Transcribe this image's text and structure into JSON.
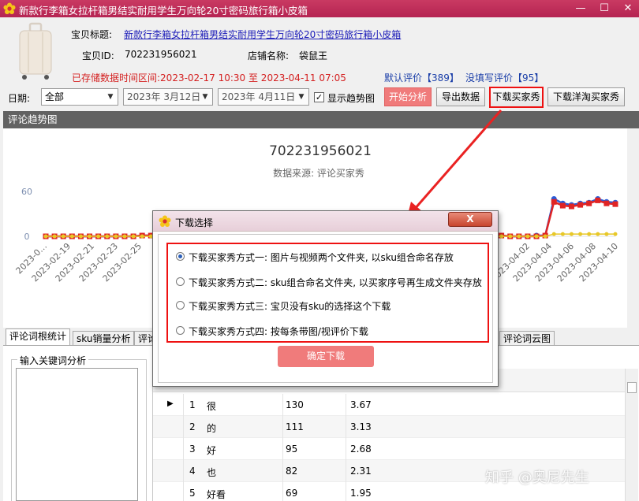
{
  "window": {
    "title": "新款行李箱女拉杆箱男结实耐用学生万向轮20寸密码旅行箱小皮箱",
    "minimize": "—",
    "maximize": "☐",
    "close": "✕"
  },
  "info": {
    "title_label": "宝贝标题:",
    "title_value": "新款行李箱女拉杆箱男结实耐用学生万向轮20寸密码旅行箱小皮箱",
    "id_label": "宝贝ID:",
    "id_value": "702231956021",
    "shop_label": "店铺名称:",
    "shop_value": "袋鼠王",
    "stored_range": "已存储数据时间区间:2023-02-17 10:30 至 2023-04-11 07:05",
    "default_reviews": "默认评价【389】",
    "no_text_reviews": "没填写评价【95】"
  },
  "toolbar": {
    "date_label": "日期:",
    "period": "全部",
    "date_from": "2023年 3月12日",
    "date_to": "2023年 4月11日",
    "show_trend": "显示趋势图",
    "start_analysis": "开始分析",
    "export": "导出数据",
    "download_buyer_show": "下载买家秀",
    "download_global_show": "下载洋淘买家秀"
  },
  "chart_panel_title": "评论趋势图",
  "chart_data": {
    "type": "line",
    "title": "702231956021",
    "subtitle": "数据来源: 评论买家秀",
    "ylim": [
      0,
      60
    ],
    "yticks": [
      "60",
      "0"
    ],
    "x_visible_left": [
      "2023-0…",
      "2023-02-19",
      "2023-02-21",
      "2023-02-23",
      "2023-02-25"
    ],
    "x_visible_right": [
      "2023-04-02",
      "2023-04-04",
      "2023-04-06",
      "2023-04-08",
      "2023-04-10"
    ],
    "series": [
      {
        "color": "#2a5bd7",
        "values": [
          0,
          0,
          0,
          0,
          0,
          0,
          0,
          0,
          0,
          0,
          0,
          1,
          1,
          1,
          1,
          1,
          0,
          1,
          1,
          1,
          1,
          1,
          1,
          1,
          1,
          1,
          1,
          1,
          1,
          1,
          1,
          1,
          1,
          1,
          1,
          1,
          1,
          1,
          1,
          1,
          1,
          1,
          1,
          1,
          1,
          1,
          1,
          1,
          1,
          1,
          1,
          1,
          1,
          0,
          0,
          0,
          1,
          1,
          50,
          44,
          42,
          44,
          45,
          50,
          46,
          45
        ]
      },
      {
        "color": "#e02424",
        "values": [
          0,
          0,
          0,
          0,
          0,
          0,
          0,
          0,
          0,
          0,
          0,
          1,
          1,
          1,
          1,
          1,
          0,
          1,
          1,
          1,
          1,
          1,
          1,
          1,
          1,
          1,
          1,
          1,
          1,
          1,
          1,
          1,
          1,
          1,
          1,
          1,
          1,
          1,
          1,
          1,
          1,
          1,
          1,
          1,
          1,
          1,
          1,
          1,
          1,
          1,
          1,
          1,
          1,
          0,
          0,
          0,
          0,
          1,
          46,
          41,
          40,
          42,
          44,
          48,
          44,
          43
        ]
      },
      {
        "color": "#e8c828",
        "values": [
          0,
          0,
          0,
          0,
          0,
          0,
          0,
          0,
          0,
          0,
          0,
          0,
          0,
          0,
          0,
          0,
          0,
          0,
          0,
          0,
          0,
          0,
          0,
          0,
          0,
          0,
          0,
          0,
          0,
          0,
          0,
          0,
          0,
          0,
          0,
          0,
          0,
          0,
          0,
          0,
          0,
          0,
          0,
          0,
          0,
          0,
          0,
          0,
          0,
          0,
          0,
          0,
          0,
          0,
          0,
          0,
          0,
          0,
          3,
          3,
          3,
          3,
          3,
          3,
          3,
          3
        ]
      }
    ]
  },
  "tabs": [
    "评论词根统计",
    "sku销量分析",
    "评论",
    "评论词云图"
  ],
  "keyword_box_title": "输入关键词分析",
  "table": {
    "rows": [
      {
        "rank": "1",
        "word": "很",
        "count": "130",
        "pct": "3.67"
      },
      {
        "rank": "2",
        "word": "的",
        "count": "111",
        "pct": "3.13"
      },
      {
        "rank": "3",
        "word": "好",
        "count": "95",
        "pct": "2.68"
      },
      {
        "rank": "4",
        "word": "也",
        "count": "82",
        "pct": "2.31"
      },
      {
        "rank": "5",
        "word": "好看",
        "count": "69",
        "pct": "1.95"
      }
    ]
  },
  "dialog": {
    "title": "下载选择",
    "close": "X",
    "options": [
      "下载买家秀方式一: 图片与视频两个文件夹, 以sku组合命名存放",
      "下载买家秀方式二: sku组合命名文件夹, 以买家序号再生成文件夹存放",
      "下载买家秀方式三: 宝贝没有sku的选择这个下载",
      "下载买家秀方式四: 按每条带图/视评价下载"
    ],
    "selected": 0,
    "confirm": "确定下载"
  },
  "watermark": "知乎 @奥尼先生"
}
